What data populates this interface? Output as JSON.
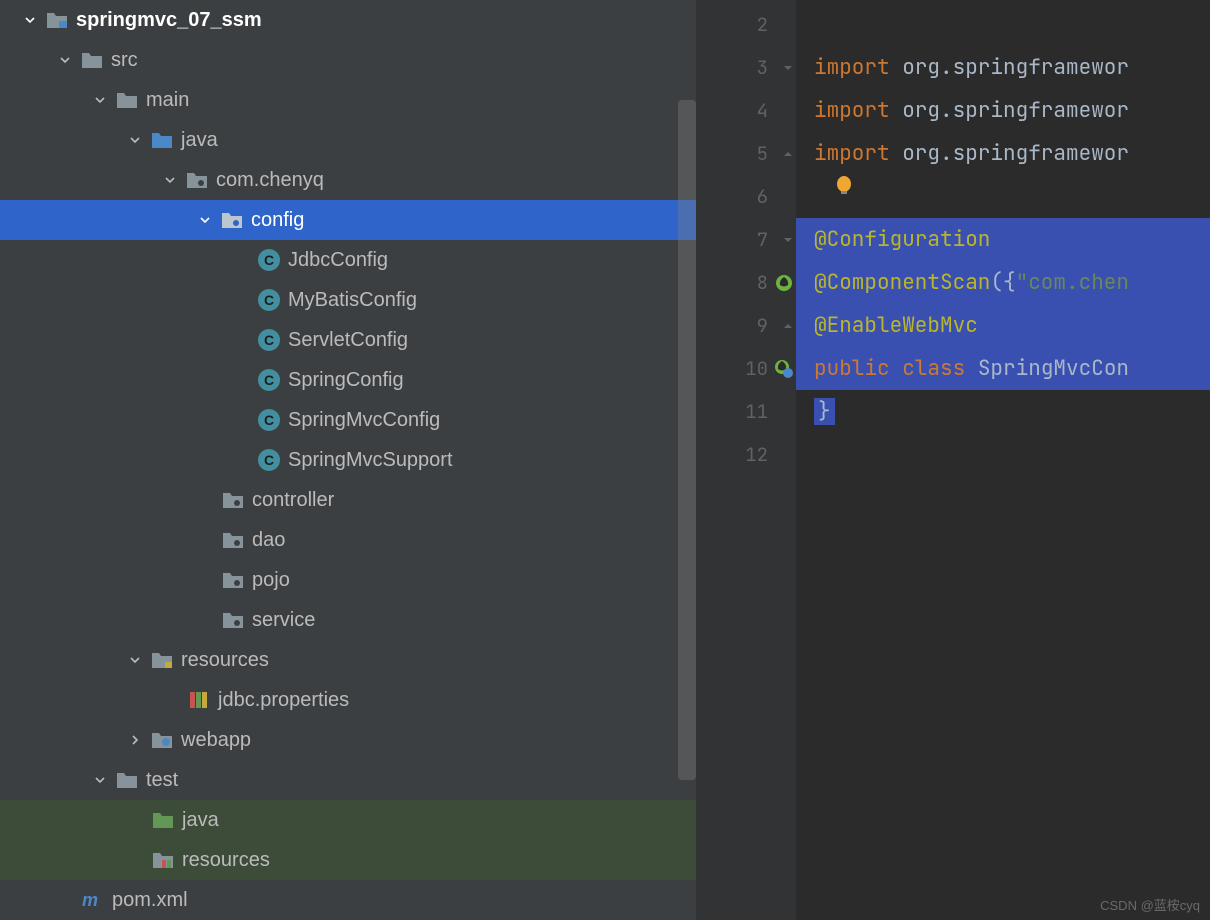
{
  "tree": {
    "root": "springmvc_07_ssm",
    "src": "src",
    "main": "main",
    "java": "java",
    "package": "com.chenyq",
    "config": "config",
    "classes": {
      "jdbc": "JdbcConfig",
      "mybatis": "MyBatisConfig",
      "servlet": "ServletConfig",
      "spring": "SpringConfig",
      "springmvc": "SpringMvcConfig",
      "springmvcsupport": "SpringMvcSupport"
    },
    "controller": "controller",
    "dao": "dao",
    "pojo": "pojo",
    "service": "service",
    "resources": "resources",
    "jdbcprops": "jdbc.properties",
    "webapp": "webapp",
    "test": "test",
    "test_java": "java",
    "test_resources": "resources",
    "pom": "pom.xml"
  },
  "gutter": {
    "l2": "2",
    "l3": "3",
    "l4": "4",
    "l5": "5",
    "l6": "6",
    "l7": "7",
    "l8": "8",
    "l9": "9",
    "l10": "10",
    "l11": "11",
    "l12": "12"
  },
  "code": {
    "line3_kw": "import",
    "line3_txt": " org.springframewor",
    "line4_kw": "import",
    "line4_txt": " org.springframewor",
    "line5_kw": "import",
    "line5_txt": " org.springframewor",
    "line7": "@Configuration",
    "line8_ann": "@ComponentScan",
    "line8_txt": "({",
    "line8_str": "\"com.chen",
    "line9": "@EnableWebMvc",
    "line10_kw1": "public",
    "line10_kw2": " class",
    "line10_txt": " SpringMvcCon",
    "line11": "}"
  },
  "watermark": "CSDN @蓝桉cyq"
}
